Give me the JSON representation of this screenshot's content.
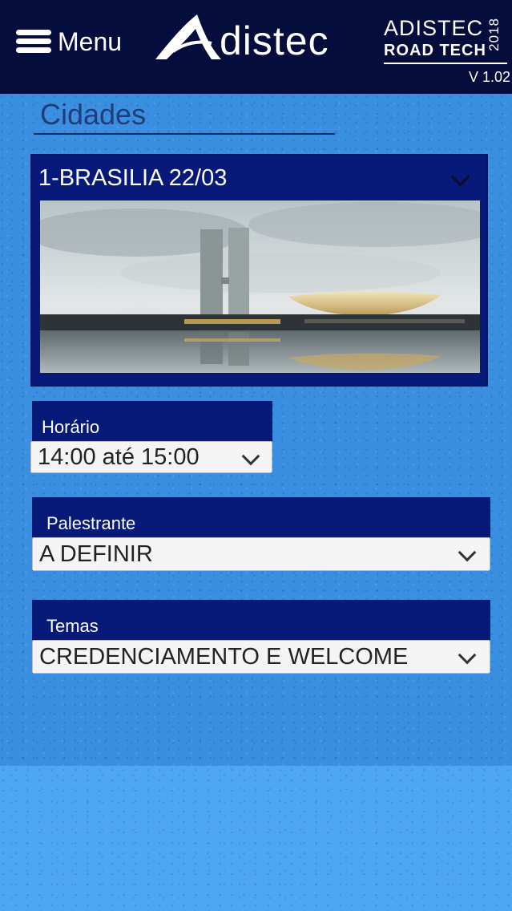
{
  "header": {
    "menu_label": "Menu",
    "brand": "distec",
    "event_line1": "ADISTEC",
    "event_line2": "ROAD TECH",
    "event_year": "2018",
    "version": "V 1.02"
  },
  "section": {
    "title": "Cidades"
  },
  "city": {
    "selected": "1-BRASILIA 22/03",
    "photo": "brasilia-congress-photo"
  },
  "horario": {
    "label": "Horário",
    "value": "14:00 até 15:00"
  },
  "palestrante": {
    "label": "Palestrante",
    "value": "A DEFINIR"
  },
  "temas": {
    "label": "Temas",
    "value": "CREDENCIAMENTO E WELCOME"
  },
  "colors": {
    "header": "#050d3d",
    "panel": "#071a7a",
    "background": "#3b8fe0"
  }
}
